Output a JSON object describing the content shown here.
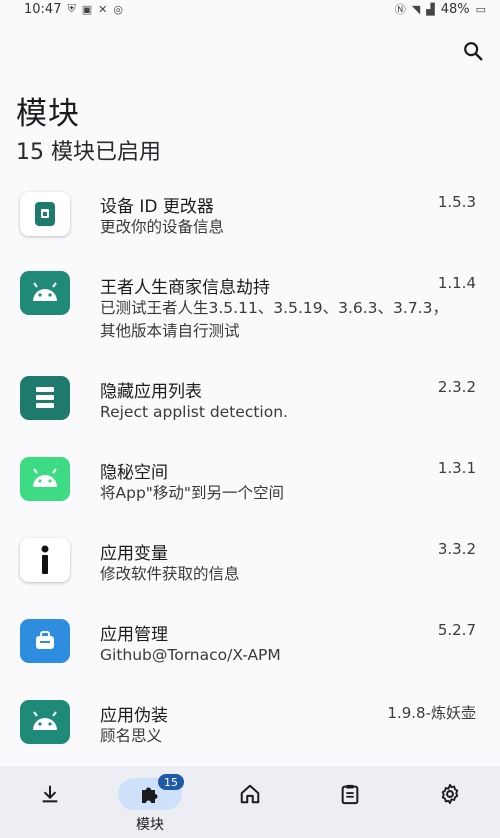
{
  "status_bar": {
    "time": "10:47",
    "battery": "48%"
  },
  "header": {
    "title": "模块",
    "subtitle": "15 模块已启用"
  },
  "modules": [
    {
      "name": "设备 ID 更改器",
      "description": "更改你的设备信息",
      "version": "1.5.3",
      "icon": "device-id-icon",
      "icon_bg": "#ffffff"
    },
    {
      "name": "王者人生商家信息劫持",
      "description": "已测试王者人生3.5.11、3.5.19、3.6.3、3.7.3，其他版本请自行测试",
      "version": "1.1.4",
      "icon": "android-icon",
      "icon_bg": "#1f8a78"
    },
    {
      "name": "隐藏应用列表",
      "description": "Reject applist detection.",
      "version": "2.3.2",
      "icon": "list-icon",
      "icon_bg": "#1f7a6e"
    },
    {
      "name": "隐秘空间",
      "description": "将App\"移动\"到另一个空间",
      "version": "1.3.1",
      "icon": "android-icon",
      "icon_bg": "#3ddc84"
    },
    {
      "name": "应用变量",
      "description": "修改软件获取的信息",
      "version": "3.3.2",
      "icon": "info-icon",
      "icon_bg": "#ffffff"
    },
    {
      "name": "应用管理",
      "description": "Github@Tornaco/X-APM",
      "version": "5.2.7",
      "icon": "app-manager-icon",
      "icon_bg": "#2f8de0"
    },
    {
      "name": "应用伪装",
      "description": "顾名思义",
      "version": "1.9.8-炼妖壶",
      "icon": "android-icon",
      "icon_bg": "#1f8a78"
    }
  ],
  "bottom_nav": {
    "items": [
      {
        "id": "download",
        "label": "",
        "icon": "download-icon"
      },
      {
        "id": "modules",
        "label": "模块",
        "icon": "puzzle-icon",
        "badge": "15",
        "active": true
      },
      {
        "id": "home",
        "label": "",
        "icon": "home-icon"
      },
      {
        "id": "logs",
        "label": "",
        "icon": "clipboard-icon"
      },
      {
        "id": "settings",
        "label": "",
        "icon": "gear-icon"
      }
    ]
  },
  "colors": {
    "background": "#fafafc",
    "nav_background": "#eceef4",
    "active_pill": "#cfe0fb",
    "badge": "#1e5aa8"
  }
}
